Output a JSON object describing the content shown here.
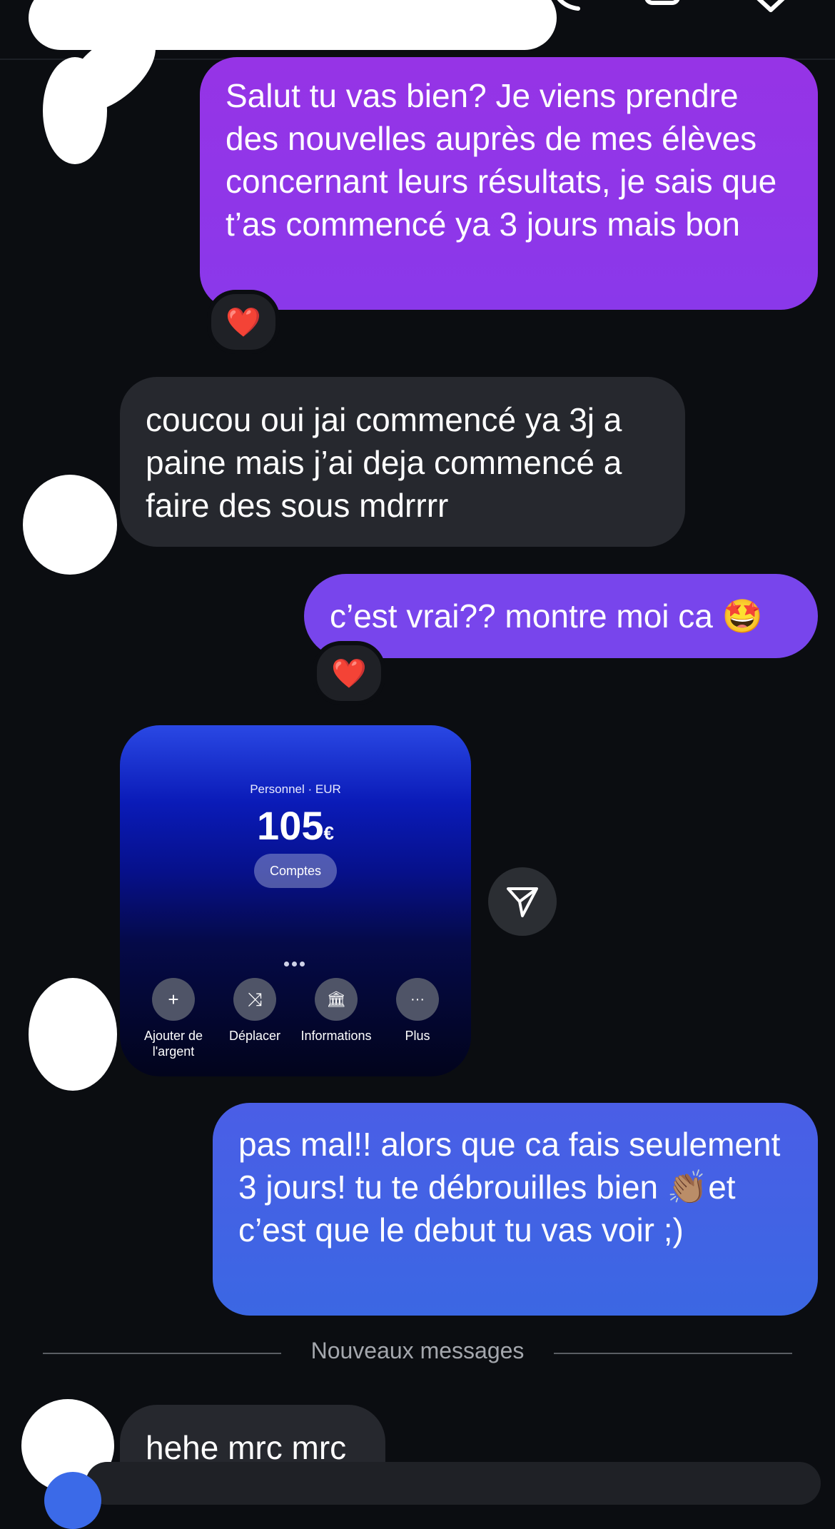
{
  "colors": {
    "background": "#0b0d11",
    "sent_purple": "#9634e6",
    "sent_violet": "#7845ec",
    "sent_blue": "#3b67e3",
    "received": "#26282e"
  },
  "header": {
    "icons": [
      "phone-icon",
      "video-camera-icon",
      "tag-icon"
    ]
  },
  "messages": [
    {
      "type": "sent",
      "text": "Salut tu vas bien? Je viens prendre des nouvelles auprès de mes élèves concernant leurs résultats, je sais que t’as commencé ya 3 jours mais bon",
      "reaction": "❤️"
    },
    {
      "type": "received",
      "text": "coucou oui jai commencé ya 3j a paine mais j’ai deja commencé a faire des sous mdrrrr"
    },
    {
      "type": "sent",
      "text": "c’est vrai?? montre moi ca 🤩",
      "reaction": "❤️"
    },
    {
      "type": "received_image"
    },
    {
      "type": "sent",
      "text": "pas mal!! alors que ca fais seulement 3 jours! tu te débrouilles bien 👏🏽et c’est que le debut tu vas voir ;)"
    },
    {
      "type": "received",
      "text": "hehe mrc mrc"
    }
  ],
  "shared_card": {
    "account_label": "Personnel · EUR",
    "amount": "105",
    "currency": "€",
    "accounts_button": "Comptes",
    "actions": [
      {
        "icon": "plus-icon",
        "glyph": "+",
        "label": "Ajouter de l'argent"
      },
      {
        "icon": "shuffle-icon",
        "glyph": "⤨",
        "label": "Déplacer"
      },
      {
        "icon": "bank-icon",
        "glyph": "🏛",
        "label": "Informations"
      },
      {
        "icon": "more-icon",
        "glyph": "···",
        "label": "Plus"
      }
    ]
  },
  "separator": {
    "label": "Nouveaux messages"
  }
}
